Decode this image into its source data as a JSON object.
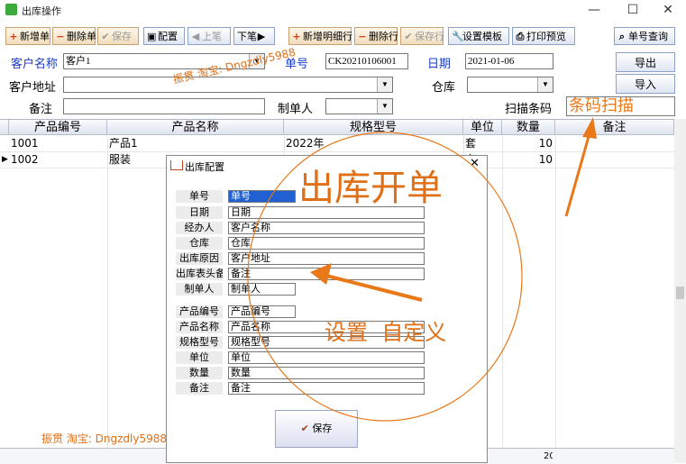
{
  "window": {
    "title": "出库操作",
    "minimize": "—",
    "maximize": "☐",
    "close": "✕"
  },
  "toolbar": {
    "new_doc": "新增单",
    "del_doc": "删除单",
    "save": "保存",
    "config": "配置",
    "prev": "上笔",
    "next": "下笔",
    "new_row": "新增明细行",
    "del_row": "删除行",
    "save_row": "保存行",
    "template": "设置模板",
    "print_preview": "打印预览",
    "query": "单号查询"
  },
  "form": {
    "customer_label": "客户名称",
    "customer_value": "客户1",
    "docno_label": "单号",
    "docno_value": "CK20210106001",
    "date_label": "日期",
    "date_value": "2021-01-06",
    "address_label": "客户地址",
    "address_value": "",
    "warehouse_label": "仓库",
    "warehouse_value": "",
    "remark_label": "备注",
    "remark_value": "",
    "maker_label": "制单人",
    "maker_value": "",
    "barcode_label": "扫描条码",
    "barcode_value": "条码扫描",
    "export_label": "导出",
    "import_label": "导入"
  },
  "grid": {
    "headers": [
      "产品编号",
      "产品名称",
      "规格型号",
      "单位",
      "数量",
      "备注"
    ],
    "rows": [
      {
        "code": "1001",
        "name": "产品1",
        "spec": "2022年",
        "unit": "套",
        "qty": "10",
        "note": ""
      },
      {
        "code": "1002",
        "name": "服装",
        "spec": "",
        "unit": "套",
        "qty": "10",
        "note": ""
      }
    ],
    "total": "20"
  },
  "dialog": {
    "title": "出库配置",
    "close": "✕",
    "fields": [
      {
        "label": "单号",
        "value": "单号"
      },
      {
        "label": "日期",
        "value": "日期"
      },
      {
        "label": "经办人",
        "value": "客户名称"
      },
      {
        "label": "仓库",
        "value": "仓库"
      },
      {
        "label": "出库原因",
        "value": "客户地址"
      },
      {
        "label": "出库表头备注",
        "value": "备注"
      },
      {
        "label": "制单人",
        "value": "制单人"
      },
      {
        "label": "产品编号",
        "value": "产品编号"
      },
      {
        "label": "产品名称",
        "value": "产品名称"
      },
      {
        "label": "规格型号",
        "value": "规格型号"
      },
      {
        "label": "单位",
        "value": "单位"
      },
      {
        "label": "数量",
        "value": "数量"
      },
      {
        "label": "备注",
        "value": "备注"
      }
    ],
    "save_label": "保存"
  },
  "annotations": {
    "big": "出库开单",
    "custom": "设置  自定义",
    "watermark_top": "振贯  淘宝: Dngzdly5988",
    "watermark_bottom": "振贯  淘宝: Dngzdly5988"
  },
  "colors": {
    "annotation": "#e87818",
    "label_blue": "#1a3ccc"
  }
}
